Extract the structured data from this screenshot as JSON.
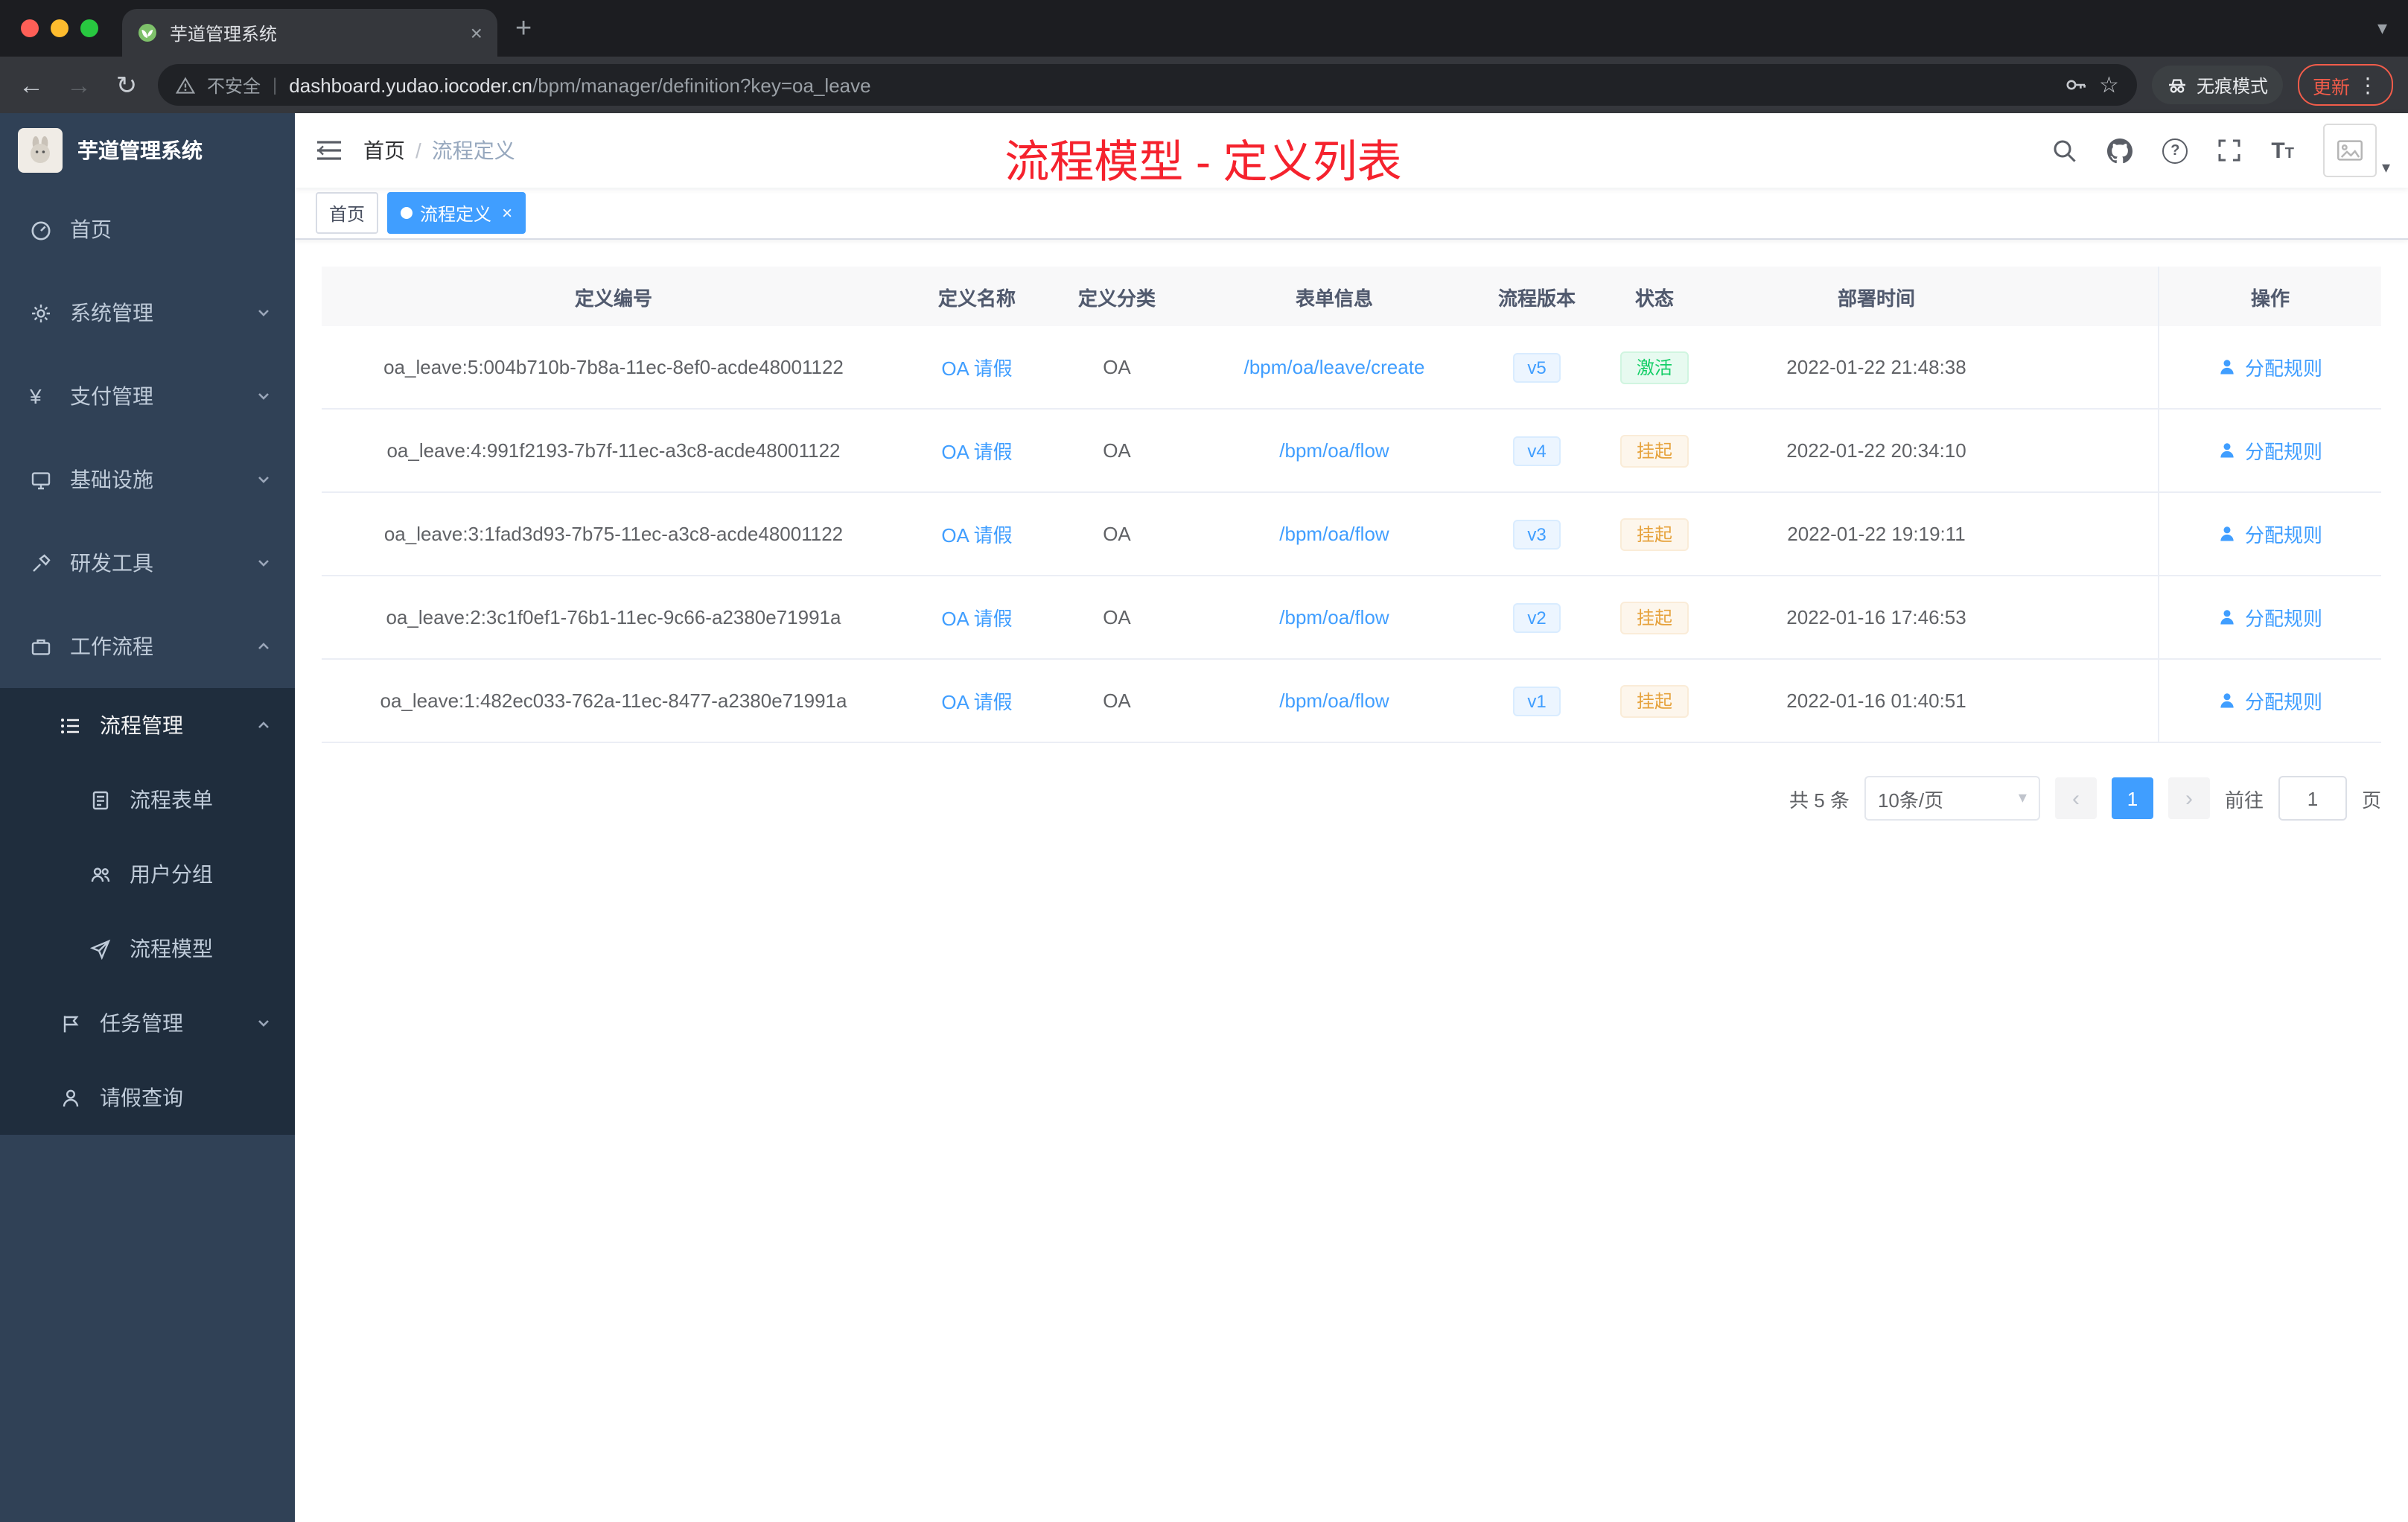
{
  "colors": {
    "accent": "#409eff",
    "annotation_red": "#f5222d",
    "success": "#13ce66",
    "warning": "#e6a23c",
    "sidebar_bg": "#304156",
    "submenu_bg": "#1f2d3d"
  },
  "glyphs": {
    "back": "←",
    "forward": "→",
    "reload": "↻",
    "plus": "+",
    "tab_close": "×",
    "tab_search": "▾",
    "star": "☆",
    "kebab": "⋮",
    "divider": "|",
    "question": "?",
    "caret_down": "▾",
    "prev": "‹",
    "next": "›",
    "tag_close": "×",
    "breadcrumb_sep": "/"
  },
  "browser": {
    "tab_title": "芋道管理系统",
    "security_label": "不安全",
    "url_host": "dashboard.yudao.iocoder.cn",
    "url_path": "/bpm/manager/definition?key=oa_leave",
    "incognito_label": "无痕模式",
    "update_label": "更新"
  },
  "sidebar": {
    "logo_title": "芋道管理系统",
    "items": [
      {
        "label": "首页"
      },
      {
        "label": "系统管理"
      },
      {
        "label": "支付管理"
      },
      {
        "label": "基础设施"
      },
      {
        "label": "研发工具"
      },
      {
        "label": "工作流程"
      },
      {
        "label": "流程管理"
      },
      {
        "label": "流程表单"
      },
      {
        "label": "用户分组"
      },
      {
        "label": "流程模型"
      },
      {
        "label": "任务管理"
      },
      {
        "label": "请假查询"
      }
    ]
  },
  "navbar": {
    "breadcrumb_home": "首页",
    "breadcrumb_current": "流程定义",
    "annotation": "流程模型 - 定义列表"
  },
  "tags": {
    "home": "首页",
    "active": "流程定义"
  },
  "table": {
    "headers": [
      "定义编号",
      "定义名称",
      "定义分类",
      "表单信息",
      "流程版本",
      "状态",
      "部署时间",
      "操作"
    ],
    "rows": [
      {
        "id": "oa_leave:5:004b710b-7b8a-11ec-8ef0-acde48001122",
        "name": "OA 请假",
        "category": "OA",
        "form": "/bpm/oa/leave/create",
        "version": "v5",
        "status": "激活",
        "time": "2022-01-22 21:48:38",
        "action": "分配规则"
      },
      {
        "id": "oa_leave:4:991f2193-7b7f-11ec-a3c8-acde48001122",
        "name": "OA 请假",
        "category": "OA",
        "form": "/bpm/oa/flow",
        "version": "v4",
        "status": "挂起",
        "time": "2022-01-22 20:34:10",
        "action": "分配规则"
      },
      {
        "id": "oa_leave:3:1fad3d93-7b75-11ec-a3c8-acde48001122",
        "name": "OA 请假",
        "category": "OA",
        "form": "/bpm/oa/flow",
        "version": "v3",
        "status": "挂起",
        "time": "2022-01-22 19:19:11",
        "action": "分配规则"
      },
      {
        "id": "oa_leave:2:3c1f0ef1-76b1-11ec-9c66-a2380e71991a",
        "name": "OA 请假",
        "category": "OA",
        "form": "/bpm/oa/flow",
        "version": "v2",
        "status": "挂起",
        "time": "2022-01-16 17:46:53",
        "action": "分配规则"
      },
      {
        "id": "oa_leave:1:482ec033-762a-11ec-8477-a2380e71991a",
        "name": "OA 请假",
        "category": "OA",
        "form": "/bpm/oa/flow",
        "version": "v1",
        "status": "挂起",
        "time": "2022-01-16 01:40:51",
        "action": "分配规则"
      }
    ]
  },
  "pagination": {
    "total": "共 5 条",
    "page_size": "10条/页",
    "current": "1",
    "goto_label": "前往",
    "unit_label": "页",
    "goto_value": "1"
  }
}
